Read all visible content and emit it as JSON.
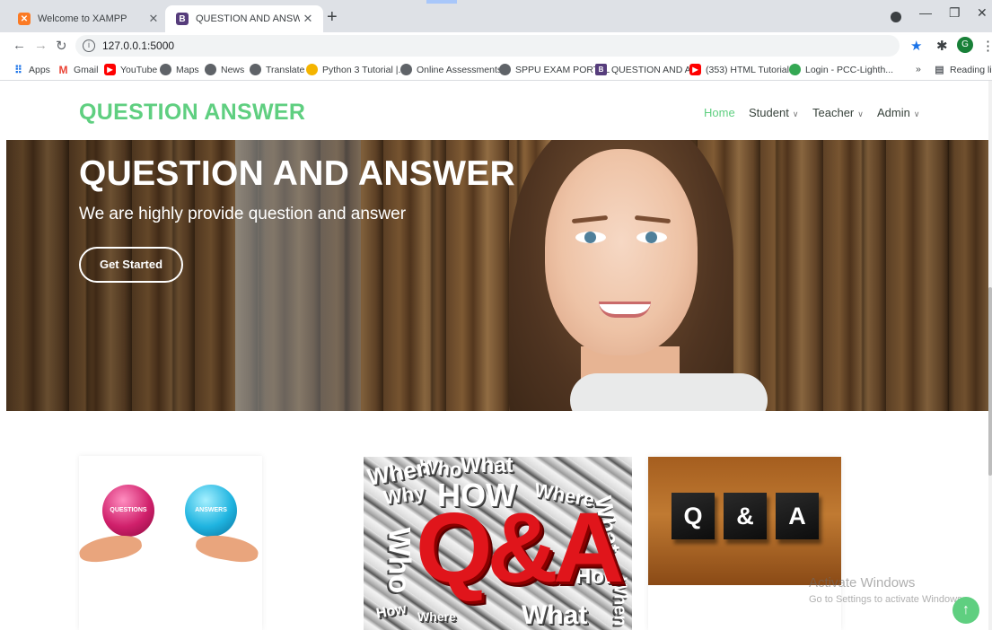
{
  "browser": {
    "tabs": [
      {
        "title": "Welcome to XAMPP",
        "favicon": "xampp-icon"
      },
      {
        "title": "QUESTION AND ANSWER",
        "favicon": "bootstrap-icon"
      }
    ],
    "address": "127.0.0.1:5000",
    "profile_initial": "G",
    "bookmarks": [
      {
        "label": "Apps",
        "icon": "apps-grid-icon"
      },
      {
        "label": "Gmail",
        "icon": "gmail-icon"
      },
      {
        "label": "YouTube",
        "icon": "youtube-icon"
      },
      {
        "label": "Maps",
        "icon": "globe-icon"
      },
      {
        "label": "News",
        "icon": "globe-icon"
      },
      {
        "label": "Translate",
        "icon": "globe-icon"
      },
      {
        "label": "Python 3 Tutorial |...",
        "icon": "python-icon"
      },
      {
        "label": "Online Assessments...",
        "icon": "globe-icon"
      },
      {
        "label": "SPPU EXAM PORTAL",
        "icon": "globe-icon"
      },
      {
        "label": "QUESTION AND A...",
        "icon": "bootstrap-icon"
      },
      {
        "label": "(353) HTML Tutorial...",
        "icon": "youtube-icon"
      },
      {
        "label": "Login - PCC-Lighth...",
        "icon": "pcc-icon"
      }
    ],
    "more_bookmarks": "»",
    "reading_list": "Reading list"
  },
  "site": {
    "logo": "QUESTION ANSWER",
    "menu": [
      {
        "label": "Home",
        "active": true
      },
      {
        "label": "Student",
        "dropdown": true
      },
      {
        "label": "Teacher",
        "dropdown": true
      },
      {
        "label": "Admin",
        "dropdown": true
      }
    ],
    "hero": {
      "title": "QUESTION AND ANSWER",
      "subtitle": "We are highly provide question and answer",
      "button": "Get Started"
    },
    "cards": {
      "orb_questions": "QUESTIONS",
      "orb_answers": "ANSWERS",
      "qa_big": "Q&A",
      "cube_letters": [
        "Q",
        "&",
        "A"
      ]
    },
    "accent_color": "#5fcf80"
  },
  "windows_watermark": {
    "title": "Activate Windows",
    "subtitle": "Go to Settings to activate Windows."
  }
}
